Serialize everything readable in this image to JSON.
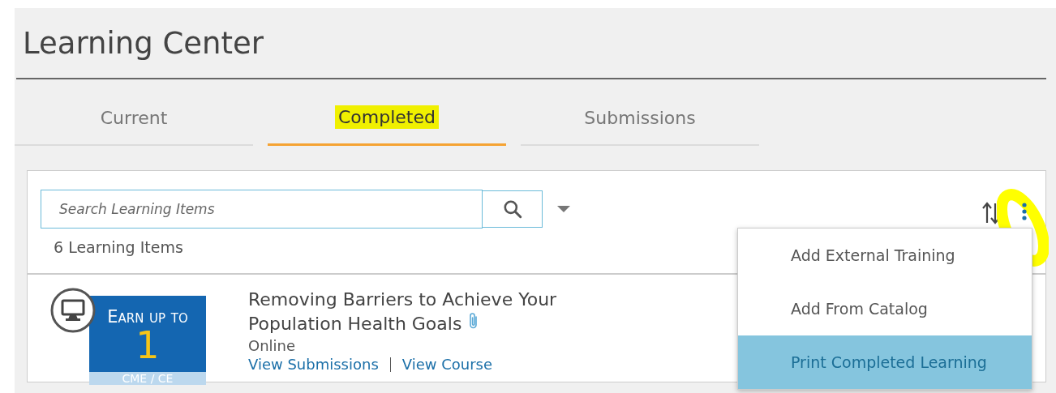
{
  "page": {
    "title": "Learning Center"
  },
  "tabs": [
    {
      "label": "Current",
      "selected": false,
      "highlighted": false
    },
    {
      "label": "Completed",
      "selected": true,
      "highlighted": true
    },
    {
      "label": "Submissions",
      "selected": false,
      "highlighted": false
    }
  ],
  "search": {
    "placeholder": "Search Learning Items"
  },
  "count": "6 Learning Items",
  "menu": {
    "annotated": true,
    "items": [
      {
        "label": "Add External Training",
        "selected": false
      },
      {
        "label": "Add From Catalog",
        "selected": false
      },
      {
        "label": "Print Completed Learning",
        "selected": true
      }
    ]
  },
  "items": [
    {
      "badge_top": "Earn up to",
      "badge_number": "1",
      "badge_bottom": "CME / CE",
      "title": "Removing Barriers to Achieve Your Population Health Goals",
      "attachment": true,
      "type": "Online",
      "links": [
        "View Submissions",
        "View Course"
      ]
    }
  ]
}
